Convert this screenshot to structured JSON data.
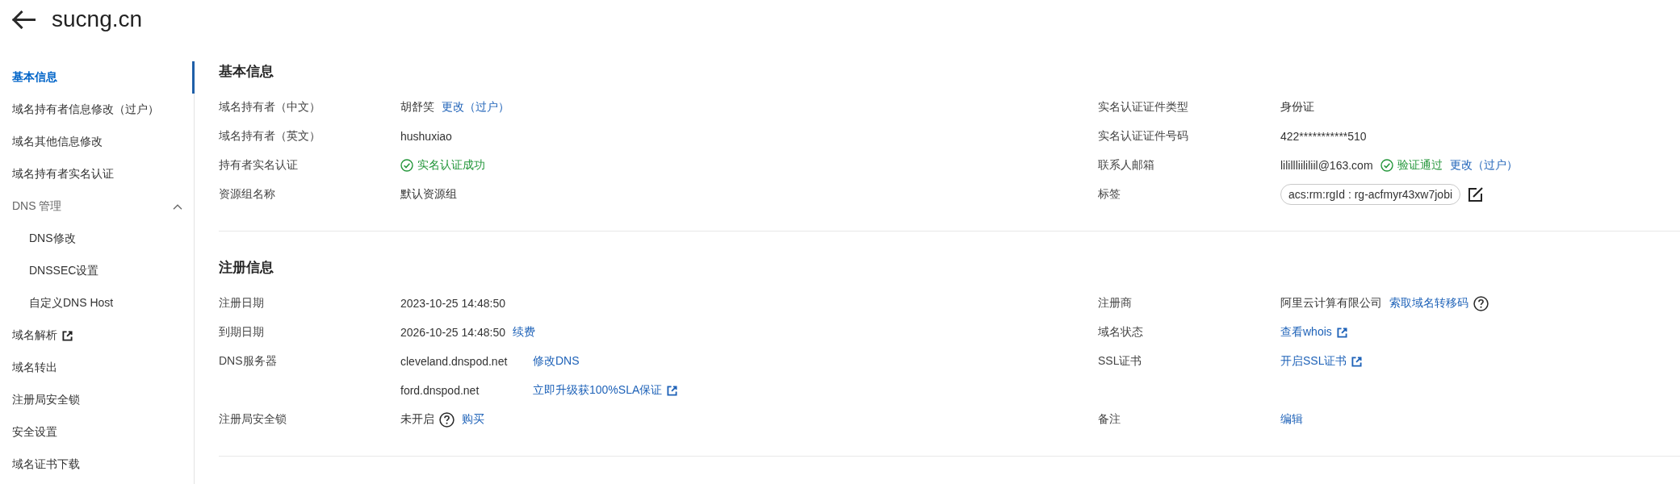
{
  "header": {
    "title": "sucng.cn"
  },
  "sidebar": {
    "items": [
      {
        "kind": "item",
        "label": "基本信息",
        "selected": true,
        "external": false
      },
      {
        "kind": "item",
        "label": "域名持有者信息修改（过户）",
        "selected": false,
        "external": false
      },
      {
        "kind": "item",
        "label": "域名其他信息修改",
        "selected": false,
        "external": false
      },
      {
        "kind": "item",
        "label": "域名持有者实名认证",
        "selected": false,
        "external": false
      },
      {
        "kind": "group",
        "label": "DNS 管理",
        "selected": false,
        "external": false,
        "expanded": true,
        "children": [
          {
            "label": "DNS修改",
            "selected": false
          },
          {
            "label": "DNSSEC设置",
            "selected": false
          },
          {
            "label": "自定义DNS Host",
            "selected": false
          }
        ]
      },
      {
        "kind": "item",
        "label": "域名解析",
        "selected": false,
        "external": true
      },
      {
        "kind": "item",
        "label": "域名转出",
        "selected": false,
        "external": false
      },
      {
        "kind": "item",
        "label": "注册局安全锁",
        "selected": false,
        "external": false
      },
      {
        "kind": "item",
        "label": "安全设置",
        "selected": false,
        "external": false
      },
      {
        "kind": "item",
        "label": "域名证书下载",
        "selected": false,
        "external": false
      }
    ]
  },
  "sections": [
    {
      "title": "基本信息",
      "rows": [
        {
          "cells": [
            {
              "label": "域名持有者（中文）",
              "value": [
                {
                  "kind": "text",
                  "text": "胡舒笑"
                },
                {
                  "kind": "link",
                  "text": "更改（过户）"
                }
              ]
            },
            {
              "label": "实名认证证件类型",
              "value": [
                {
                  "kind": "text",
                  "text": "身份证"
                }
              ]
            }
          ]
        },
        {
          "cells": [
            {
              "label": "域名持有者（英文）",
              "value": [
                {
                  "kind": "text",
                  "text": "hushuxiao"
                }
              ]
            },
            {
              "label": "实名认证证件号码",
              "value": [
                {
                  "kind": "text",
                  "text": "422***********510"
                }
              ]
            }
          ]
        },
        {
          "cells": [
            {
              "label": "持有者实名认证",
              "value": [
                {
                  "kind": "success",
                  "text": "实名认证成功"
                }
              ]
            },
            {
              "label": "联系人邮箱",
              "value": [
                {
                  "kind": "text",
                  "text": "lilillliililiil@163.com"
                },
                {
                  "kind": "success",
                  "text": "验证通过"
                },
                {
                  "kind": "link",
                  "text": "更改（过户）"
                }
              ]
            }
          ]
        },
        {
          "cells": [
            {
              "label": "资源组名称",
              "value": [
                {
                  "kind": "text",
                  "text": "默认资源组"
                }
              ]
            },
            {
              "label": "标签",
              "value": [
                {
                  "kind": "tag",
                  "text": "acs:rm:rgId : rg-acfmyr43xw7jobi",
                  "editable": true
                }
              ]
            }
          ]
        }
      ]
    },
    {
      "title": "注册信息",
      "rows": [
        {
          "cells": [
            {
              "label": "注册日期",
              "value": [
                {
                  "kind": "text",
                  "text": "2023-10-25 14:48:50"
                }
              ]
            },
            {
              "label": "注册商",
              "value": [
                {
                  "kind": "text",
                  "text": "阿里云计算有限公司"
                },
                {
                  "kind": "link",
                  "text": "索取域名转移码",
                  "help": true
                }
              ]
            }
          ]
        },
        {
          "cells": [
            {
              "label": "到期日期",
              "value": [
                {
                  "kind": "text",
                  "text": "2026-10-25 14:48:50"
                },
                {
                  "kind": "link",
                  "text": "续费"
                }
              ]
            },
            {
              "label": "域名状态",
              "value": [
                {
                  "kind": "link",
                  "text": "查看whois",
                  "external": true
                }
              ]
            }
          ]
        },
        {
          "cells": [
            {
              "label": "DNS服务器",
              "value": [
                {
                  "kind": "host",
                  "text": "cleveland.dnspod.net"
                },
                {
                  "kind": "link",
                  "text": "修改DNS"
                }
              ]
            },
            {
              "label": "SSL证书",
              "value": [
                {
                  "kind": "link",
                  "text": "开启SSL证书",
                  "external": true
                }
              ]
            }
          ]
        },
        {
          "cells": [
            {
              "value": [
                {
                  "kind": "host",
                  "text": "ford.dnspod.net"
                },
                {
                  "kind": "link",
                  "text": "立即升级获100%SLA保证",
                  "external": true
                }
              ]
            }
          ]
        },
        {
          "cells": [
            {
              "label": "注册局安全锁",
              "value": [
                {
                  "kind": "text",
                  "text": "未开启",
                  "help": true
                },
                {
                  "kind": "link",
                  "text": "购买"
                }
              ]
            },
            {
              "label": "备注",
              "value": [
                {
                  "kind": "link",
                  "text": "编辑"
                }
              ]
            }
          ]
        }
      ]
    }
  ]
}
